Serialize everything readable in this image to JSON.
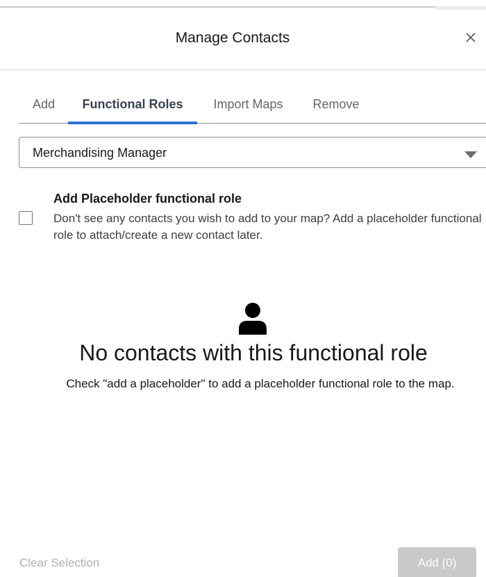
{
  "modal": {
    "title": "Manage Contacts",
    "close_icon": "close-icon"
  },
  "tabs": [
    {
      "label": "Add",
      "active": false
    },
    {
      "label": "Functional Roles",
      "active": true
    },
    {
      "label": "Import Maps",
      "active": false
    },
    {
      "label": "Remove",
      "active": false
    }
  ],
  "role_select": {
    "value": "Merchandising Manager",
    "caret_icon": "caret-down-icon"
  },
  "placeholder": {
    "checked": false,
    "title": "Add Placeholder functional role",
    "description": "Don't see any contacts you wish to add to your map? Add a placeholder functional role to attach/create a new contact later."
  },
  "empty_state": {
    "icon": "user-icon",
    "title": "No contacts with this functional role",
    "description": "Check \"add a placeholder\" to add a placeholder functional role to the map."
  },
  "footer": {
    "clear_label": "Clear Selection",
    "add_label": "Add (0)"
  },
  "colors": {
    "active_tab_underline": "#2f74d0",
    "disabled_button": "#c9c9c9",
    "disabled_text": "#b0b0b0"
  }
}
